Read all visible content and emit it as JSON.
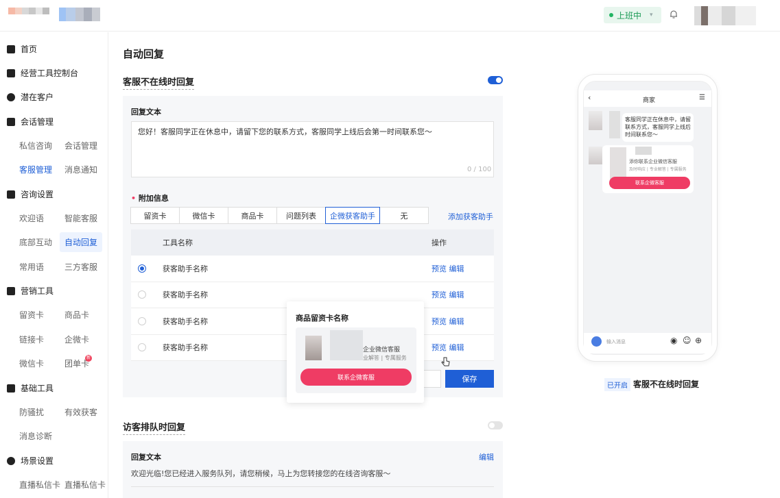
{
  "header": {
    "status": "上班中"
  },
  "sidebar": {
    "home": "首页",
    "console": "经营工具控制台",
    "leads": "潜在客户",
    "conversation": "会话管理",
    "conv_items": [
      "私信咨询",
      "会话管理",
      "客服管理",
      "消息通知"
    ],
    "consult": "咨询设置",
    "consult_items": [
      "欢迎语",
      "智能客服",
      "底部互动",
      "自动回复",
      "常用语",
      "三方客服"
    ],
    "marketing": "营销工具",
    "marketing_items": [
      "留资卡",
      "商品卡",
      "链接卡",
      "企微卡",
      "微信卡",
      "团单卡"
    ],
    "new_badge": "新",
    "basic": "基础工具",
    "basic_items": [
      "防骚扰",
      "有效获客",
      "消息诊断"
    ],
    "scene": "场景设置",
    "scene_items": [
      "直播私信卡",
      "直播私信卡"
    ]
  },
  "main": {
    "title": "自动回复",
    "section1": {
      "title": "客服不在线时回复",
      "reply_label": "回复文本",
      "reply_text": "您好！客服同学正在休息中，请留下您的联系方式，客服同学上线后会第一时间联系您～",
      "counter": "0 / 100",
      "extra_label": "附加信息",
      "required_mark": "•",
      "tabs": [
        "留资卡",
        "微信卡",
        "商品卡",
        "问题列表",
        "企微获客助手",
        "无"
      ],
      "add_link": "添加获客助手",
      "table_headers": [
        "工具名称",
        "操作"
      ],
      "rows": [
        "获客助手名称",
        "获客助手名称",
        "获客助手名称",
        "获客助手名称"
      ],
      "preview": "预览",
      "edit": "编辑",
      "save": "保存"
    },
    "popover": {
      "title": "商品留资卡名称",
      "line1": "企业微信客服",
      "line2": "业解答 | 专属服务",
      "button": "联系企微客服"
    },
    "section2": {
      "title": "访客排队时回复",
      "reply_label": "回复文本",
      "edit": "编辑",
      "reply_text": "欢迎光临!您已经进入服务队列，请您稍候，马上为您转接您的在线咨询客服～"
    }
  },
  "phone": {
    "title": "商家",
    "msg": "客服同学正在休息中，请留联系方式，客服同学上线后时间联系您～",
    "card_line1": "添你联系企业微信客服",
    "card_line2": "及时响应 | 专业解答 | 专属服务",
    "card_button": "联系企微客服",
    "input_placeholder": "输入消息"
  },
  "footer": {
    "badge": "已开启",
    "text": "客服不在线时回复"
  }
}
